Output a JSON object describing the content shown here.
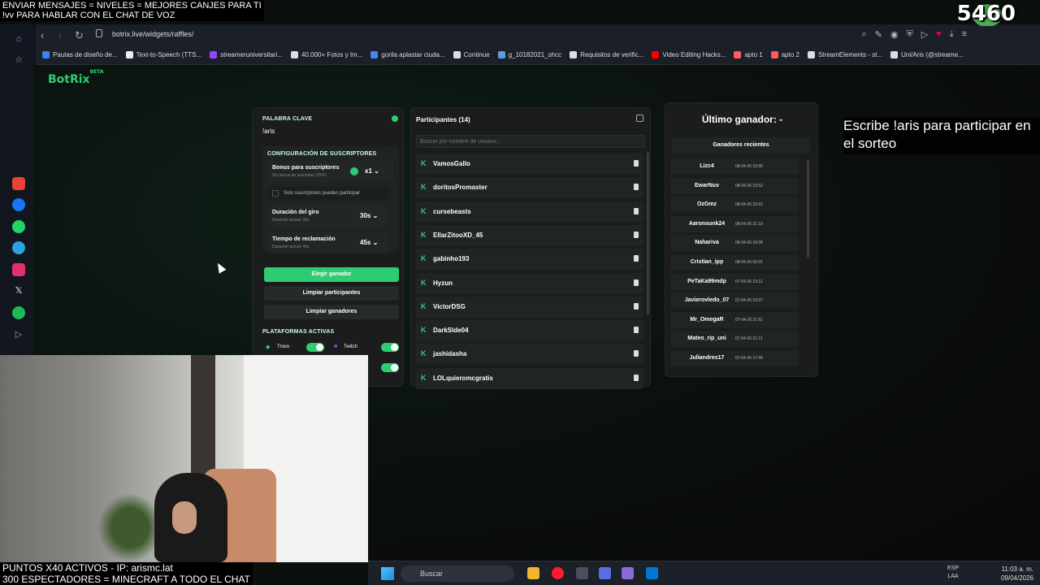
{
  "overlay": {
    "top_line1": "ENVIAR MENSAJES = NIVELES = MEJORES CANJES PARA TI",
    "top_line2": "!vv PARA HABLAR CON EL CHAT DE VOZ",
    "counter": "5460",
    "caption": "Escribe !aris para participar en el sorteo",
    "bottom_line1": "PUNTOS X40 ACTIVOS - IP: arismc.lat",
    "bottom_line2": "300 ESPECTADORES = MINECRAFT A TODO EL CHAT"
  },
  "browser": {
    "url": "botrix.live/widgets/raffles/",
    "bookmarks": [
      {
        "label": "Pautas de diseño de...",
        "color": "#3b82f6"
      },
      {
        "label": "Text-to-Speech (TTS...",
        "color": "#eeeeee"
      },
      {
        "label": "streameruniversitari...",
        "color": "#9146ff"
      },
      {
        "label": "40.000+ Fotos y Im...",
        "color": "#dddddd"
      },
      {
        "label": "gorila aplastar ciuda...",
        "color": "#4285f4"
      },
      {
        "label": "Continue",
        "color": "#dddddd"
      },
      {
        "label": "g_10182021_shcc",
        "color": "#5aa0e0"
      },
      {
        "label": "Requisitos de verific...",
        "color": "#dddddd"
      },
      {
        "label": "Video Editing Hacks...",
        "color": "#ff0000"
      },
      {
        "label": "apto 1",
        "color": "#ff5a5f"
      },
      {
        "label": "apto 2",
        "color": "#ff5a5f"
      },
      {
        "label": "StreamElements - st...",
        "color": "#dddddd"
      },
      {
        "label": "Uni/Aris (@streame...",
        "color": "#dddddd"
      }
    ]
  },
  "app": {
    "logo": "BotRix",
    "logo_badge": "BETA",
    "settings": {
      "keyword_label": "PALABRA CLAVE",
      "keyword_value": "!aris",
      "subs_config_label": "CONFIGURACIÓN DE SUSCRIPTORES",
      "bonus_title": "Bonus para suscriptores",
      "bonus_sub": "Sin bonus de suscriptor (OFF)",
      "bonus_value": "x1",
      "subs_only": "Solo suscriptores pueden participar",
      "spin_title": "Duración del giro",
      "spin_sub": "Duración actual: 30s",
      "spin_value": "30s",
      "claim_title": "Tiempo de reclamación",
      "claim_sub": "Duración actual: 45s",
      "claim_value": "45s",
      "pick_winner": "Elegir ganador",
      "clear_participants": "Limpiar participantes",
      "clear_winners": "Limpiar ganadores",
      "platforms_label": "PLATAFORMAS ACTIVAS",
      "platform1": "Trovo",
      "platform2": "Twitch"
    },
    "participants": {
      "title": "Participantes (14)",
      "search_placeholder": "Buscar por nombre de usuario...",
      "list": [
        "VamosGallo",
        "doritosPromaster",
        "cursebeasts",
        "EllarZitooXD_45",
        "gabinho193",
        "Hyzun",
        "VictorDSG",
        "DarkSlde04",
        "jashidasha",
        "LOLquieromcgratis"
      ]
    },
    "winners": {
      "last_winner": "Último ganador: -",
      "recent_title": "Ganadores recientes",
      "list": [
        {
          "name": "Lizc4",
          "date": "08-04-26 23:55"
        },
        {
          "name": "EwarNuv",
          "date": "08-04-26 23:52"
        },
        {
          "name": "OzGmz",
          "date": "08-04-26 23:51"
        },
        {
          "name": "Aaronsunk24",
          "date": "08-04-26 21:10"
        },
        {
          "name": "Nahariva",
          "date": "08-04-26 18:08"
        },
        {
          "name": "Cristian_ipp",
          "date": "08-04-26 00:31"
        },
        {
          "name": "PeTaKa99mdp",
          "date": "07-04-26 23:11"
        },
        {
          "name": "Javierovledo_07",
          "date": "07-04-26 23:07"
        },
        {
          "name": "Mr_OmegaR",
          "date": "07-04-26 21:51"
        },
        {
          "name": "Mateo_rip_uni",
          "date": "07-04-26 21:11"
        },
        {
          "name": "Juliandres17",
          "date": "07-04-26 17:49"
        }
      ]
    }
  },
  "taskbar": {
    "search": "Buscar",
    "lang1": "ESP",
    "lang2": "LAA",
    "time": "11:03 a. m.",
    "date": "09/04/2026"
  },
  "colors": {
    "accent": "#2ecc71"
  }
}
